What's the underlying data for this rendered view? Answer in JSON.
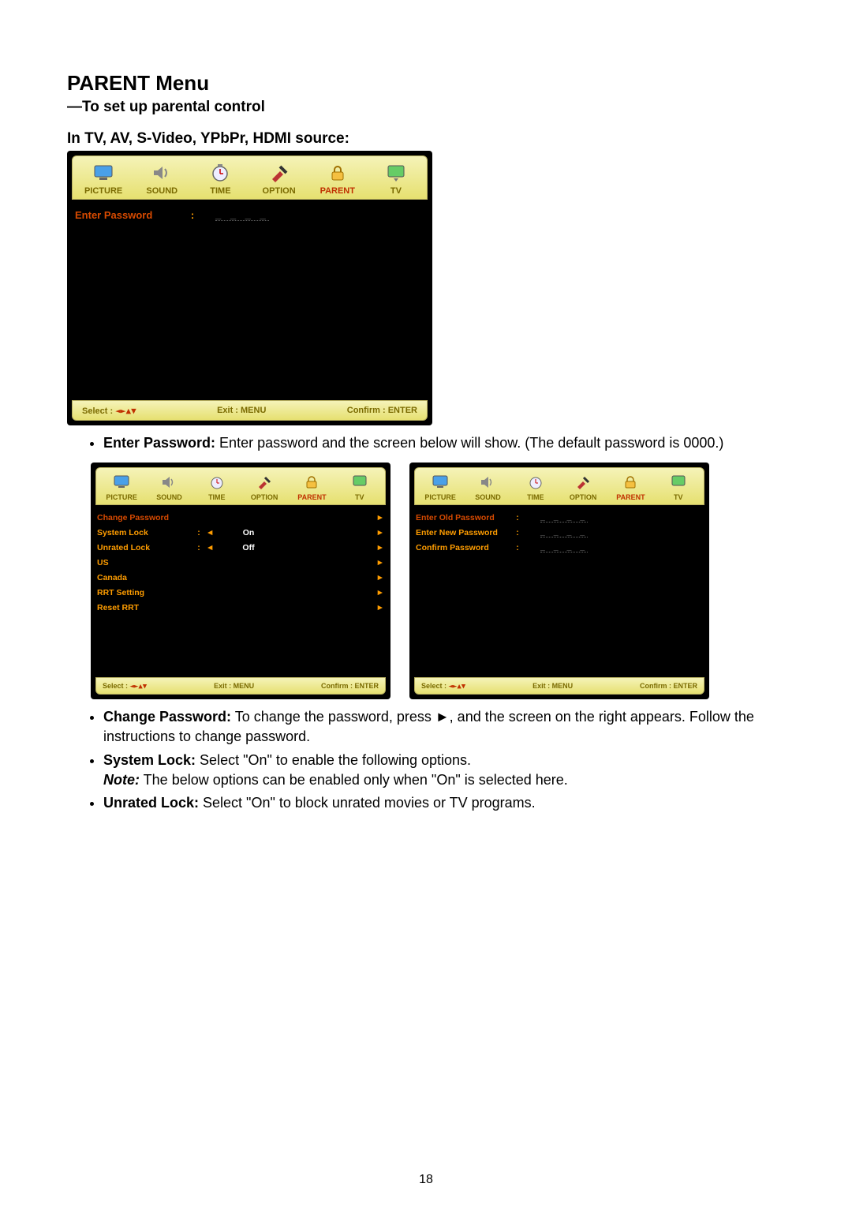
{
  "heading": "PARENT Menu",
  "subheading": "—To set up parental control",
  "sourceline": "In TV, AV, S-Video, YPbPr, HDMI source:",
  "tabs": {
    "picture": "PICTURE",
    "sound": "SOUND",
    "time": "TIME",
    "option": "OPTION",
    "parent": "PARENT",
    "tv": "TV"
  },
  "hints": {
    "select_label": "Select :",
    "select_arrows": "◄►▲▼",
    "exit": "Exit : MENU",
    "confirm": "Confirm : ENTER"
  },
  "osd1": {
    "enter_password": "Enter Password",
    "mask": "_ _ _ _"
  },
  "osd2": {
    "rows": {
      "change_password": "Change Password",
      "system_lock": "System Lock",
      "system_lock_val": "On",
      "unrated_lock": "Unrated Lock",
      "unrated_lock_val": "Off",
      "us": "US",
      "canada": "Canada",
      "rrt_setting": "RRT Setting",
      "reset_rrt": "Reset RRT"
    }
  },
  "osd3": {
    "rows": {
      "enter_old": "Enter Old Password",
      "enter_new": "Enter New Password",
      "confirm_pw": "Confirm Password",
      "mask": "_ _ _ _"
    }
  },
  "bullets": {
    "b1_label": "Enter Password:",
    "b1_text": " Enter password and the screen below will show. (The default password is 0000.)",
    "b2_label": "Change Password:",
    "b2_text": " To change the password, press ►, and the screen on the right appears. Follow the instructions to change password.",
    "b3_label": "System Lock:",
    "b3_text": " Select \"On\" to enable the following options.",
    "b3_note_label": "Note:",
    "b3_note_text": " The below options can be enabled only when \"On\" is selected here.",
    "b4_label": "Unrated Lock:",
    "b4_text": " Select \"On\" to block unrated movies or TV programs."
  },
  "page_number": "18"
}
